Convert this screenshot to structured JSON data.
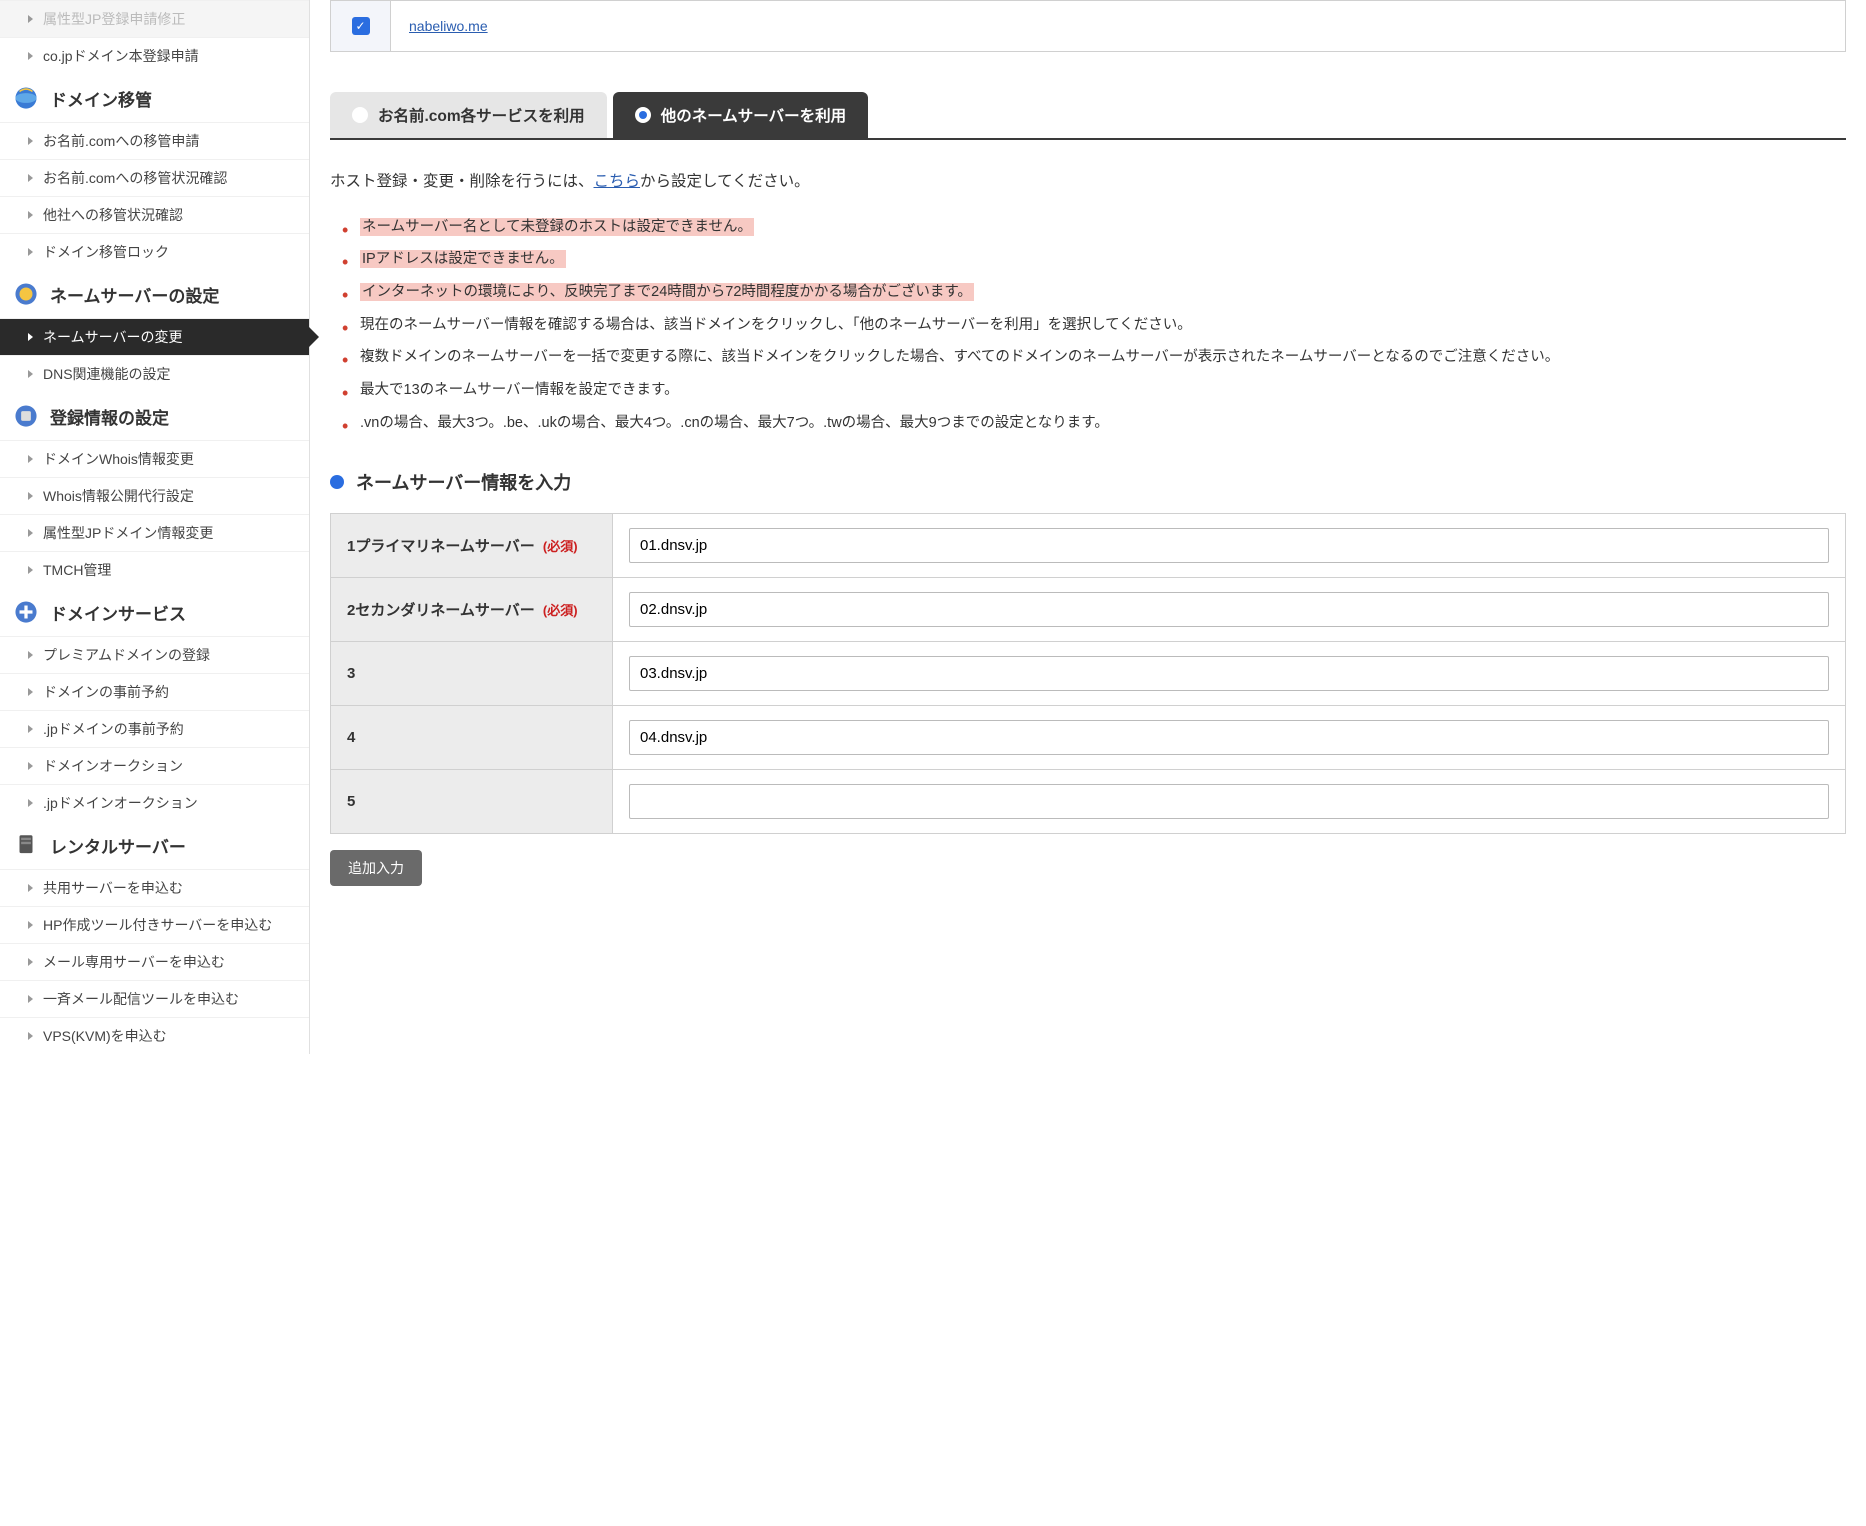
{
  "sidebar": {
    "top_items": [
      "属性型JP登録申請修正",
      "co.jpドメイン本登録申請"
    ],
    "sections": [
      {
        "title": "ドメイン移管",
        "icon": "globe",
        "items": [
          "お名前.comへの移管申請",
          "お名前.comへの移管状況確認",
          "他社への移管状況確認",
          "ドメイン移管ロック"
        ]
      },
      {
        "title": "ネームサーバーの設定",
        "icon": "gear",
        "items": [
          "ネームサーバーの変更",
          "DNS関連機能の設定"
        ],
        "active_index": 0
      },
      {
        "title": "登録情報の設定",
        "icon": "settings",
        "items": [
          "ドメインWhois情報変更",
          "Whois情報公開代行設定",
          "属性型JPドメイン情報変更",
          "TMCH管理"
        ]
      },
      {
        "title": "ドメインサービス",
        "icon": "plus",
        "items": [
          "プレミアムドメインの登録",
          "ドメインの事前予約",
          ".jpドメインの事前予約",
          "ドメインオークション",
          ".jpドメインオークション"
        ]
      },
      {
        "title": "レンタルサーバー",
        "icon": "server",
        "items": [
          "共用サーバーを申込む",
          "HP作成ツール付きサーバーを申込む",
          "メール専用サーバーを申込む",
          "一斉メール配信ツールを申込む",
          "VPS(KVM)を申込む"
        ]
      }
    ]
  },
  "domain_row": {
    "checked": true,
    "domain": "nabeliwo.me"
  },
  "tabs": {
    "inactive_label": "お名前.com各サービスを利用",
    "active_label": "他のネームサーバーを利用"
  },
  "info": {
    "prefix": "ホスト登録・変更・削除を行うには、",
    "link": "こちら",
    "suffix": "から設定してください。"
  },
  "notes": [
    {
      "text": "ネームサーバー名として未登録のホストは設定できません。",
      "hl": true
    },
    {
      "text": "IPアドレスは設定できません。",
      "hl": true
    },
    {
      "text": "インターネットの環境により、反映完了まで24時間から72時間程度かかる場合がございます。",
      "hl": true
    },
    {
      "text": "現在のネームサーバー情報を確認する場合は、該当ドメインをクリックし、「他のネームサーバーを利用」を選択してください。",
      "hl": false
    },
    {
      "text": "複数ドメインのネームサーバーを一括で変更する際に、該当ドメインをクリックした場合、すべてのドメインのネームサーバーが表示されたネームサーバーとなるのでご注意ください。",
      "hl": false
    },
    {
      "text": "最大で13のネームサーバー情報を設定できます。",
      "hl": false
    },
    {
      "text": ".vnの場合、最大3つ。.be、.ukの場合、最大4つ。.cnの場合、最大7つ。.twの場合、最大9つまでの設定となります。",
      "hl": false
    }
  ],
  "ns_section_title": "ネームサーバー情報を入力",
  "ns_rows": [
    {
      "label": "1プライマリネームサーバー",
      "required": true,
      "value": "01.dnsv.jp"
    },
    {
      "label": "2セカンダリネームサーバー",
      "required": true,
      "value": "02.dnsv.jp"
    },
    {
      "label": "3",
      "required": false,
      "value": "03.dnsv.jp"
    },
    {
      "label": "4",
      "required": false,
      "value": "04.dnsv.jp"
    },
    {
      "label": "5",
      "required": false,
      "value": ""
    }
  ],
  "required_label": "(必須)",
  "add_button": "追加入力"
}
